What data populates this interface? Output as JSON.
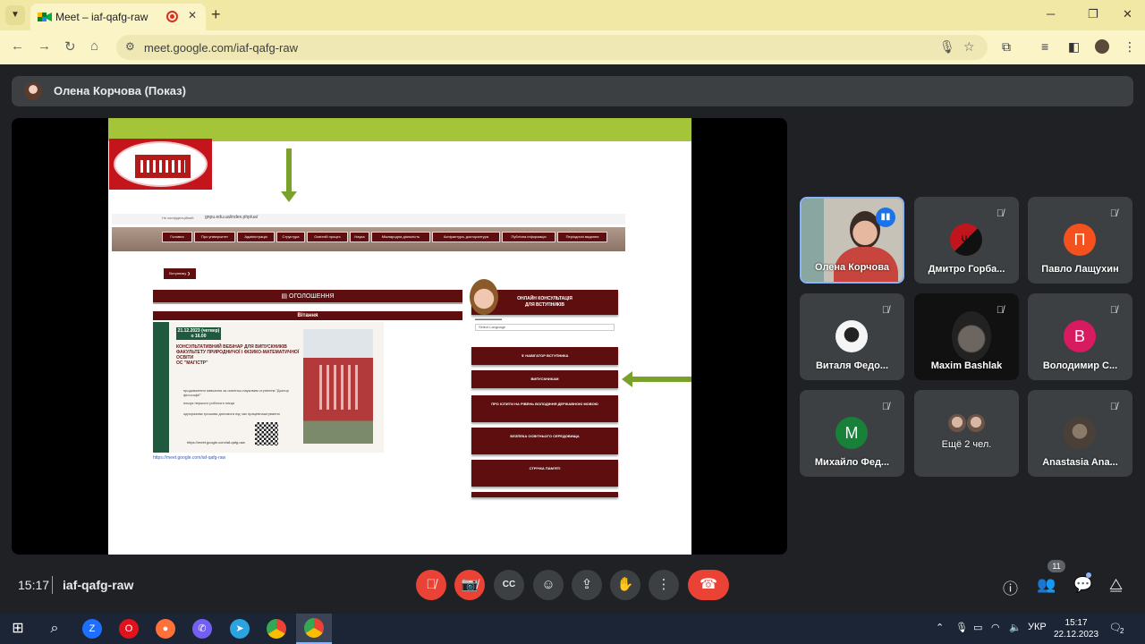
{
  "browser": {
    "tab_title": "Meet – iaf-qafg-raw",
    "url": "meet.google.com/iaf-qafg-raw",
    "tab_close": "✕",
    "new_tab": "+"
  },
  "meet": {
    "presenter": "Олена Корчова (Показ)",
    "time": "15:17",
    "meeting_code": "iaf-qafg-raw",
    "people_count": "11",
    "participants": [
      {
        "name": "Олена Корчова",
        "type": "video",
        "speaking": true
      },
      {
        "name": "Дмитро Горба...",
        "type": "flag",
        "muted": true
      },
      {
        "name": "Павло Лащухин",
        "type": "letter",
        "letter": "П",
        "color": "#f4511e",
        "muted": true
      },
      {
        "name": "Виталя Федо...",
        "type": "photo",
        "muted": true
      },
      {
        "name": "Maxim Bashlak",
        "type": "video",
        "muted": true
      },
      {
        "name": "Володимир С...",
        "type": "letter",
        "letter": "В",
        "color": "#d81b60",
        "muted": true
      },
      {
        "name": "Михайло Фед...",
        "type": "letter",
        "letter": "М",
        "color": "#188038",
        "muted": true
      },
      {
        "name": "Ещё 2 чел.",
        "type": "group"
      },
      {
        "name": "Anastasia Ana...",
        "type": "photo",
        "muted": true
      }
    ]
  },
  "slide": {
    "mini_notsecure": "Не конфіденційний",
    "mini_url": "gnpu.edu.ua/index.php/ua/",
    "menu": [
      "Головна",
      "Про університет",
      "Адміністрація",
      "Структура",
      "Освітній процес",
      "Наука",
      "Міжнародна діяльність",
      "Аспірантура, докторантура",
      "Публічна інформація",
      "Періодичні видання"
    ],
    "enter_button": "Вступнику ❯",
    "news": "▤ ОГОЛОШЕННЯ",
    "greeting": "Вітання",
    "poster_date": "21.12.2023 (четвер) о 16.00",
    "poster_title": "КОНСУЛЬТАТИВНИЙ ВЕБІНАР ДЛЯ ВИПУСКНИКІВ ФАКУЛЬТЕТУ ПРИРОДНИЧОЇ І ФІЗИКО-МАТЕМАТИЧНОЇ ОСВІТИ",
    "poster_subtitle": "ОС \"МАГІСТР\"",
    "poster_points": [
      "продовження навчання за освітньо-науковим ступенем \"Доктор філософії\"",
      "пошук першого робочого місця",
      "одноразова грошова допомога під час працевлаштування"
    ],
    "poster_link": "https://meet.google.com/iaf-qafg-raw",
    "below_link": "https://meet.google.com/iaf-qafg-raw",
    "consult": "ОНЛАЙН КОНСУЛЬТАЦІЯ",
    "consult_sub": "ДЛЯ ВСТУПНИКІВ",
    "select_language": "Select Language",
    "side_items": [
      "♛ НАВІГАТОР ВСТУПНИКА",
      "ВИПУСКНИКАМ",
      "ПРО ІСПИТИ НА РІВЕНЬ ВОЛОДІННЯ ДЕРЖАВНОЮ МОВОЮ",
      "БЕЗПЕКА ОСВІТНЬОГО СЕРЕДОВИЩА",
      "СТРІЧКА ПАМ'ЯТІ"
    ]
  },
  "taskbar": {
    "lang": "УКР",
    "time": "15:17",
    "date": "22.12.2023",
    "notifications": "2"
  }
}
